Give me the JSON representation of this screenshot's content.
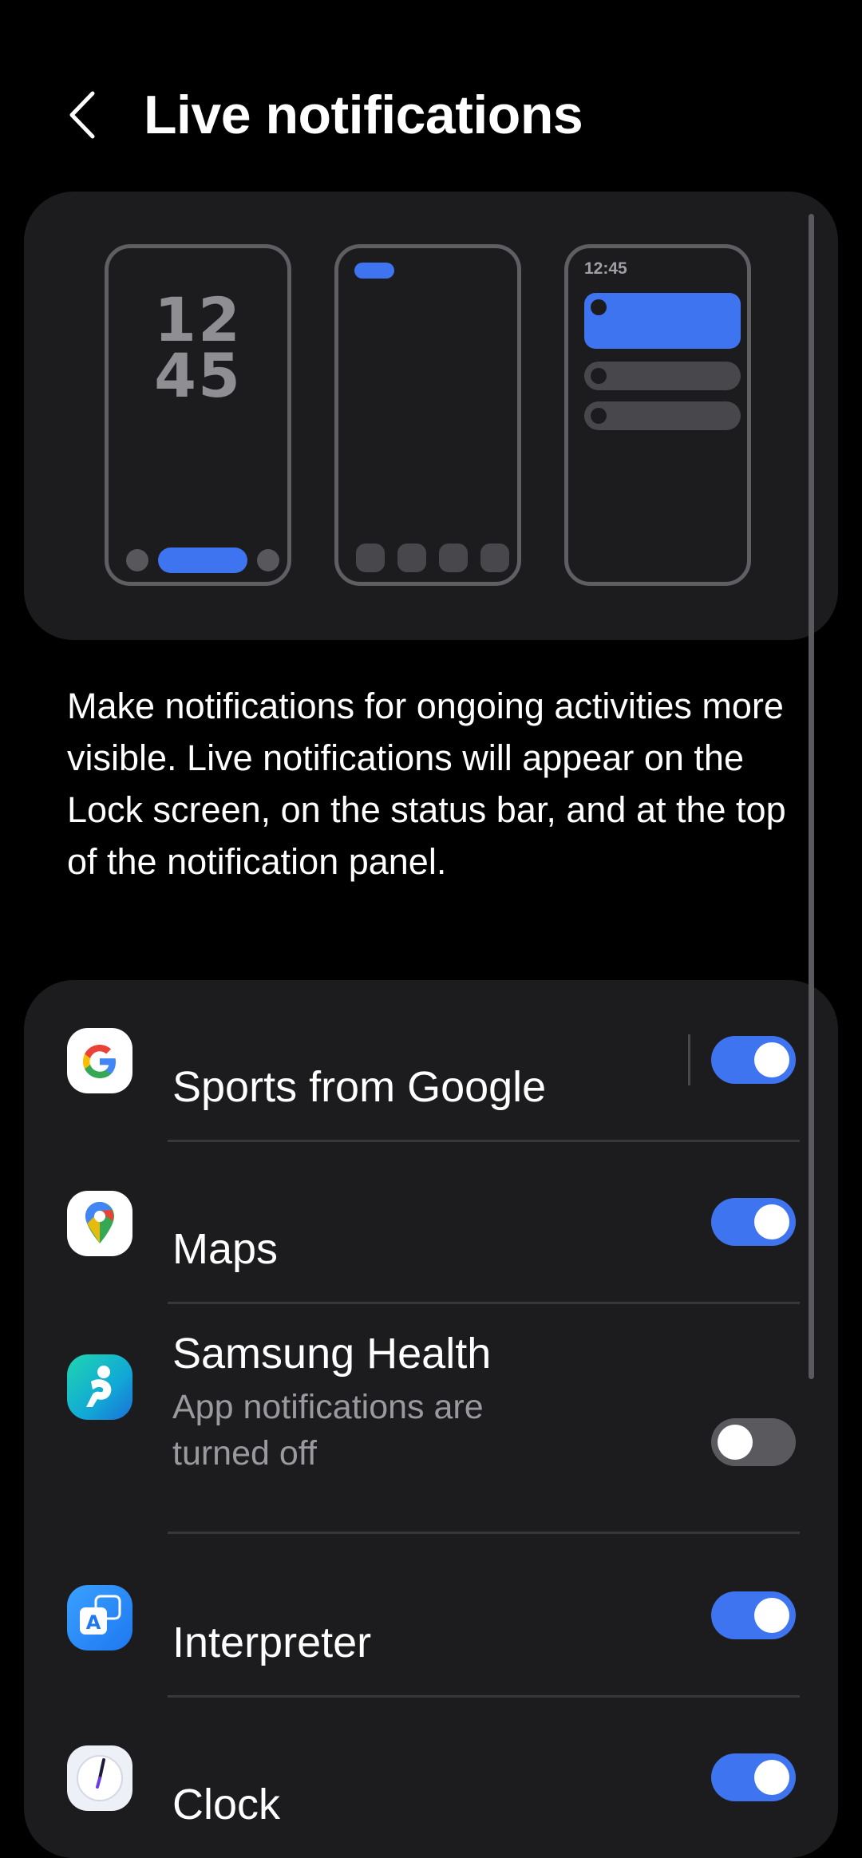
{
  "header": {
    "back_icon": "chevron-left-icon",
    "title": "Live notifications"
  },
  "preview": {
    "lock_clock_hour": "12",
    "lock_clock_minute": "45",
    "panel_time": "12:45"
  },
  "description": "Make notifications for ongoing activities more visible. Live notifications will appear on the Lock screen, on the status bar, and at the top of the notification panel.",
  "apps": [
    {
      "label": "Sports from Google",
      "subtitle": "",
      "icon": "google-icon",
      "enabled": true
    },
    {
      "label": "Maps",
      "subtitle": "",
      "icon": "google-maps-icon",
      "enabled": true
    },
    {
      "label": "Samsung Health",
      "subtitle": "App notifications are turned off",
      "icon": "samsung-health-icon",
      "enabled": false
    },
    {
      "label": "Interpreter",
      "subtitle": "",
      "icon": "interpreter-icon",
      "enabled": true
    },
    {
      "label": "Clock",
      "subtitle": "",
      "icon": "clock-icon",
      "enabled": true
    }
  ],
  "colors": {
    "background": "#000000",
    "card": "#1c1c1e",
    "accent": "#3e74f0",
    "toggle_off": "#5a5a5e",
    "secondary_text": "#9a9a9e"
  }
}
